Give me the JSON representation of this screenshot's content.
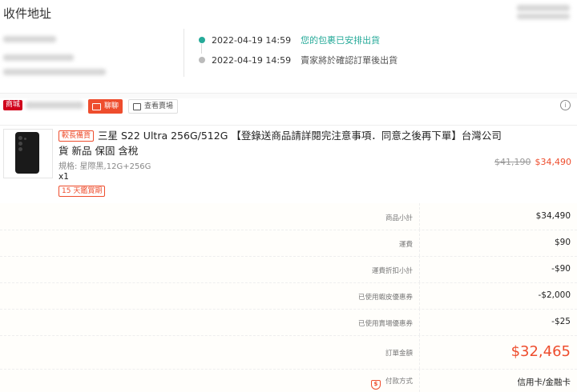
{
  "address": {
    "title": "收件地址"
  },
  "timeline": [
    {
      "time": "2022-04-19 14:59",
      "text": "您的包裹已安排出貨",
      "color": "#26aa99",
      "active": true
    },
    {
      "time": "2022-04-19 14:59",
      "text": "賣家將於確認訂單後出貨",
      "color": "#bbbbbb",
      "active": false
    }
  ],
  "shop": {
    "mall_badge": "商城",
    "chat_label": "聊聊",
    "view_shop_label": "查看賣場"
  },
  "product": {
    "tag": "較長備貨",
    "title": "三星 S22 Ultra 256G/512G 【登錄送商品請詳閱完注意事項．同意之後再下單】台灣公司貨 新品 保固 含稅",
    "variant": "規格: 星際黑,12G+256G",
    "qty": "x1",
    "return_tag": "15 天鑑賞期",
    "price_old": "$41,190",
    "price_new": "$34,490"
  },
  "summary": [
    {
      "label": "商品小計",
      "value": "$34,490"
    },
    {
      "label": "運費",
      "value": "$90"
    },
    {
      "label": "運費折扣小計",
      "value": "-$90"
    },
    {
      "label": "已使用蝦皮優惠券",
      "value": "-$2,000"
    },
    {
      "label": "已使用賣場優惠券",
      "value": "-$25"
    },
    {
      "label": "訂單金額",
      "value": "$32,465"
    },
    {
      "label": "付款方式",
      "value": "信用卡/金融卡"
    }
  ],
  "colors": {
    "accent": "#ee4d2d",
    "mall": "#d0011b",
    "teal": "#26aa99"
  }
}
